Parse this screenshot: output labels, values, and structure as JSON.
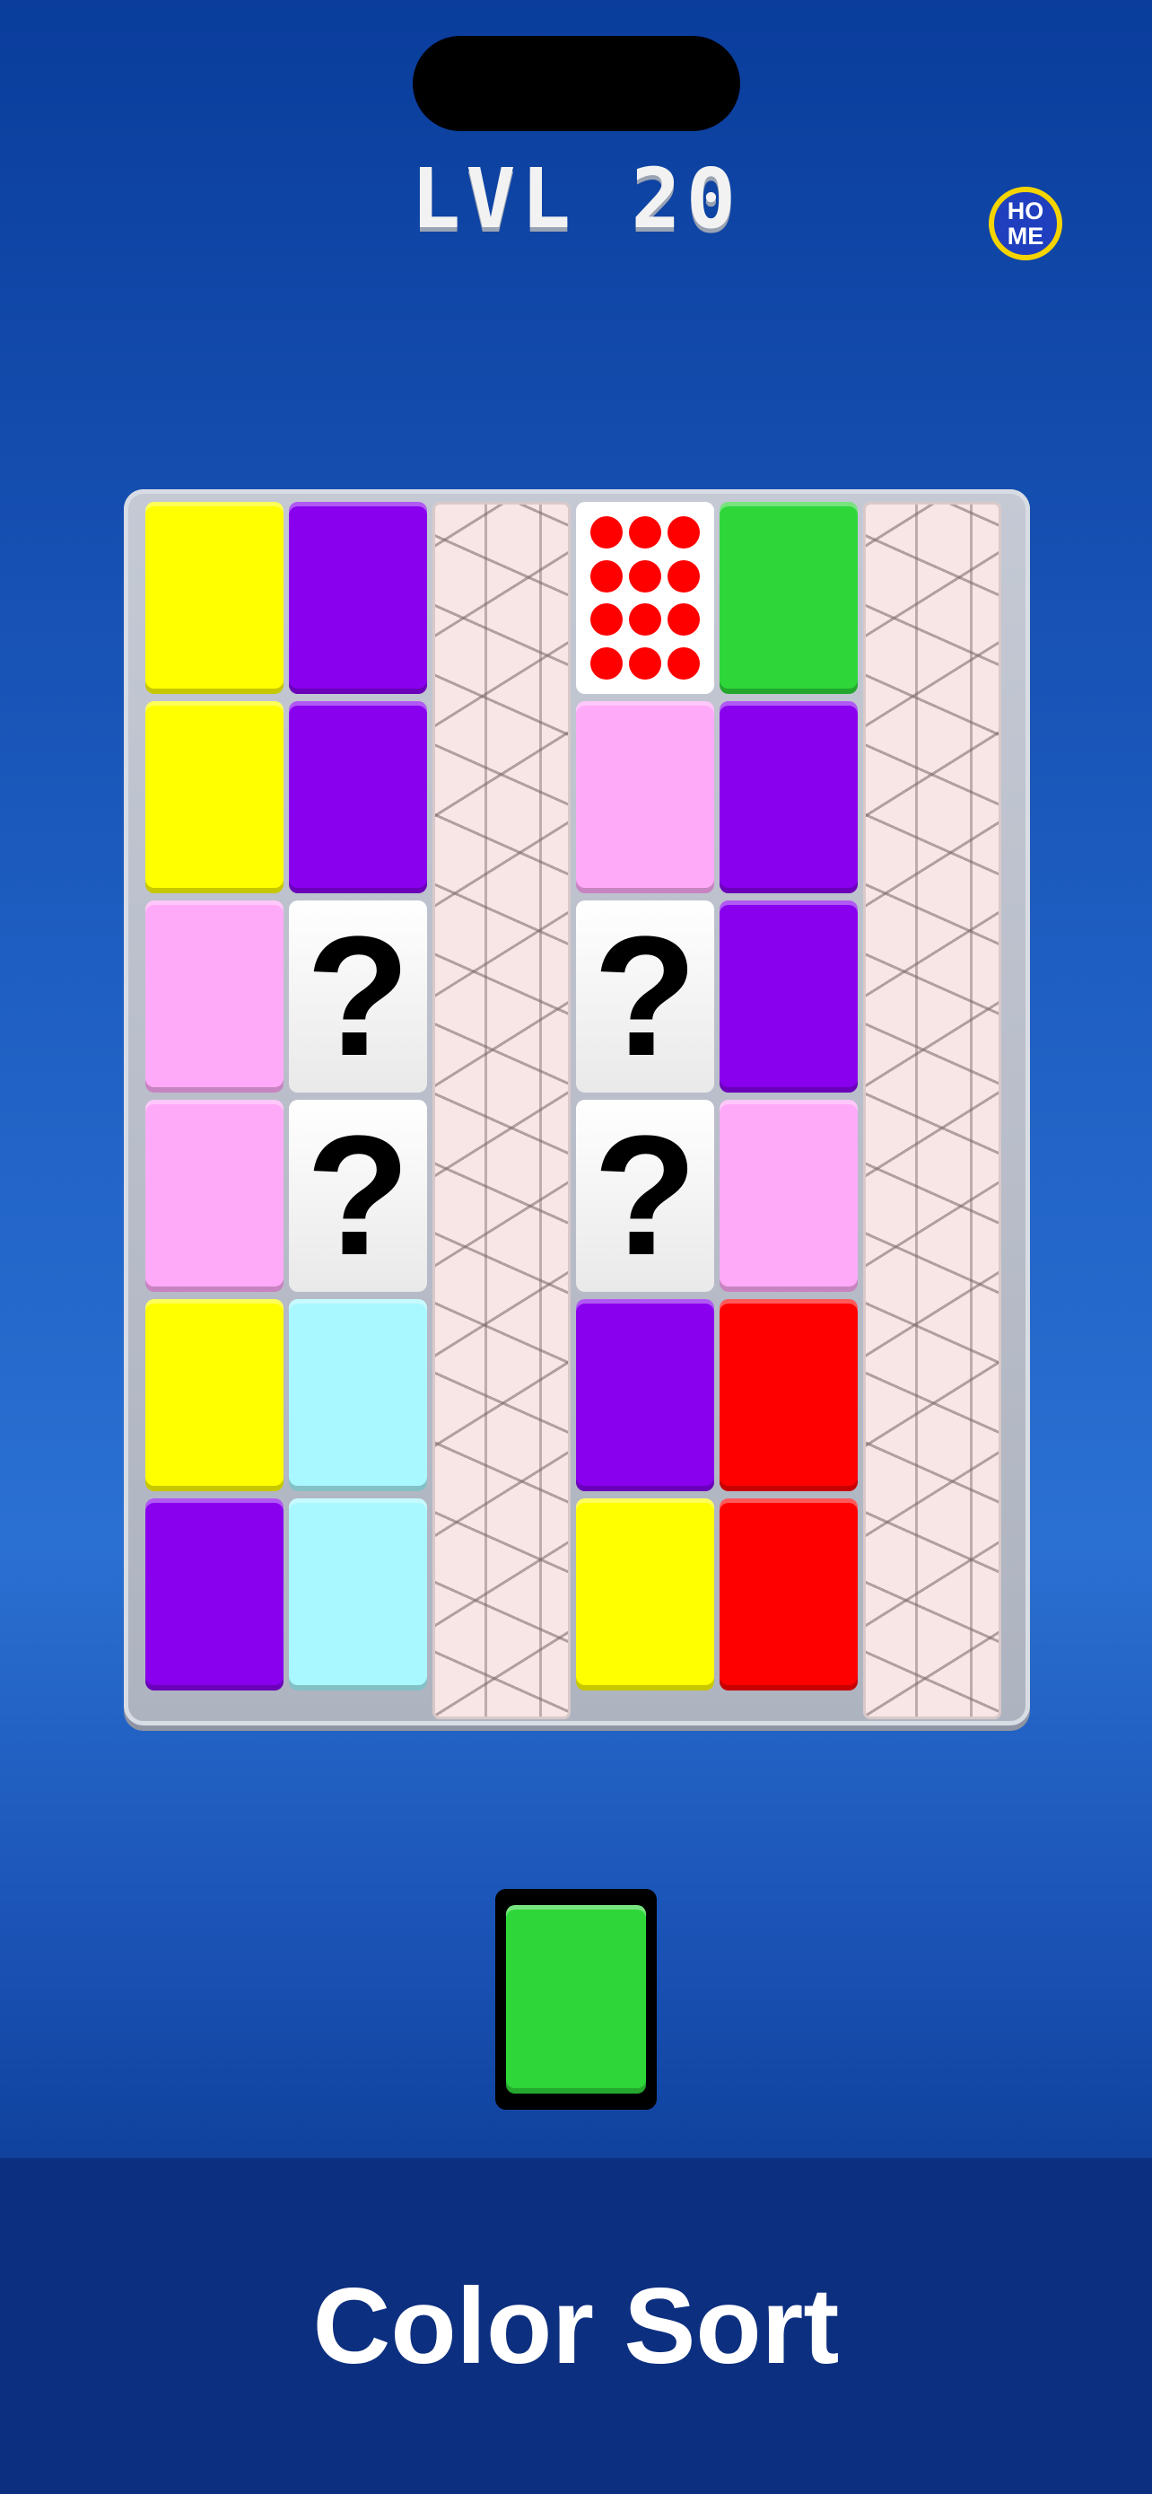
{
  "header": {
    "level_label": "LVL 20",
    "home_label_top": "HO",
    "home_label_bottom": "ME"
  },
  "colors": {
    "yellow": "#ffff00",
    "purple": "#8800ee",
    "pink": "#ffaaf8",
    "cyan": "#aaf8ff",
    "red": "#ff0000",
    "green": "#2fd63a"
  },
  "board": {
    "rows": 6,
    "columns": [
      {
        "type": "tiles",
        "cells": [
          "yellow",
          "yellow",
          "pink",
          "pink",
          "yellow",
          "purple"
        ]
      },
      {
        "type": "tiles",
        "cells": [
          "purple",
          "purple",
          "mystery",
          "mystery",
          "cyan",
          "cyan"
        ]
      },
      {
        "type": "stone"
      },
      {
        "type": "tiles",
        "cells": [
          "dots",
          "pink",
          "mystery",
          "mystery",
          "purple",
          "yellow"
        ]
      },
      {
        "type": "tiles",
        "cells": [
          "green",
          "purple",
          "purple",
          "pink",
          "red",
          "red"
        ]
      },
      {
        "type": "stone"
      }
    ],
    "mystery_symbol": "?"
  },
  "selected_tile": {
    "color": "green"
  },
  "footer": {
    "title": "Color Sort"
  }
}
